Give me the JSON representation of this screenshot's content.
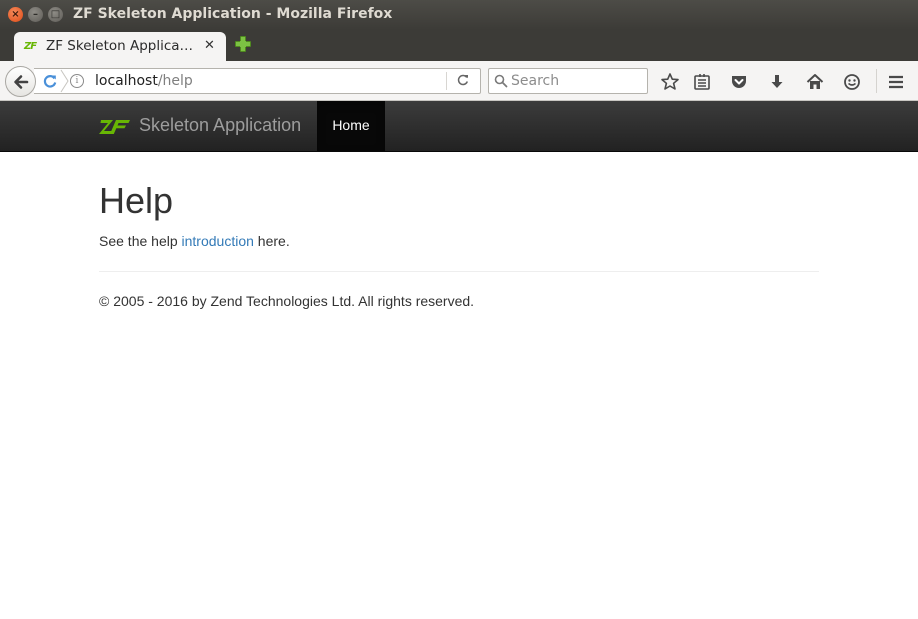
{
  "window": {
    "title": "ZF Skeleton Application - Mozilla Firefox",
    "close_glyph": "×",
    "min_glyph": "–",
    "max_glyph": "□"
  },
  "tab": {
    "favicon_text": "ZF",
    "label": "ZF Skeleton Applica…",
    "close_glyph": "✕"
  },
  "urlbar": {
    "host": "localhost",
    "path": "/help",
    "info_glyph": "i"
  },
  "search": {
    "placeholder": "Search"
  },
  "toolbar_icons": [
    "star-icon",
    "reading-list-icon",
    "pocket-icon",
    "download-icon",
    "home-icon",
    "smiley-icon",
    "menu-icon"
  ],
  "site": {
    "brand": "Skeleton Application",
    "logo_text": "ZF",
    "nav_home": "Home",
    "heading": "Help",
    "lead_before": "See the help ",
    "lead_link": "introduction",
    "lead_after": " here.",
    "footer": "© 2005 - 2016 by Zend Technologies Ltd. All rights reserved."
  },
  "colors": {
    "zf_green": "#68b604",
    "link": "#337ab7",
    "navbar_dark": "#222222"
  }
}
